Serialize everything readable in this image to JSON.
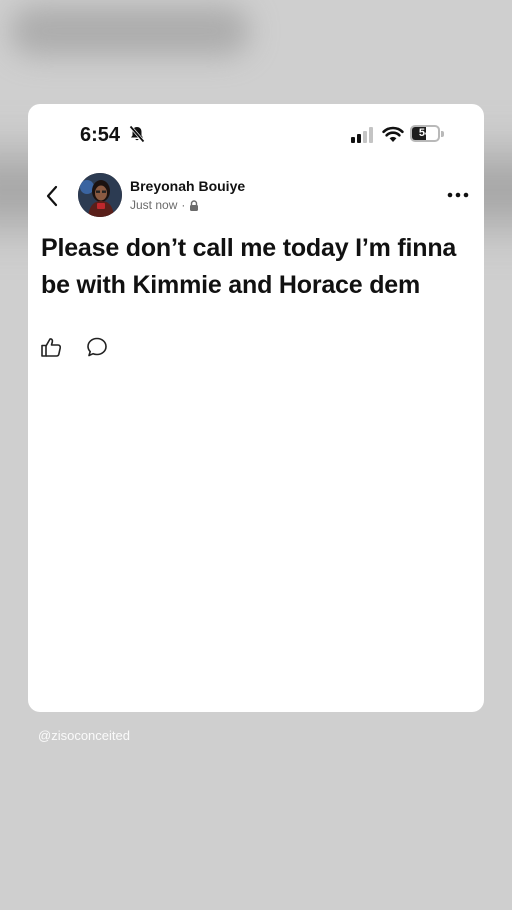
{
  "status_bar": {
    "time": "6:54",
    "battery_percent": "54",
    "battery_level": 0.54,
    "icons": [
      "bell-muted-icon",
      "signal-icon",
      "wifi-icon",
      "battery-icon"
    ]
  },
  "post": {
    "author_name": "Breyonah Bouiye",
    "timestamp": "Just now",
    "separator": "·",
    "privacy_icon": "lock-icon",
    "text": "Please don’t call me today I’m finna be with Kimmie and Horace dem"
  },
  "actions": {
    "icons": [
      "like-icon",
      "comment-icon"
    ]
  },
  "watermark": "@zisoconceited",
  "colors": {
    "background": "#cfcfcf",
    "card": "#ffffff",
    "text": "#111111",
    "muted": "#6b6b6b"
  }
}
